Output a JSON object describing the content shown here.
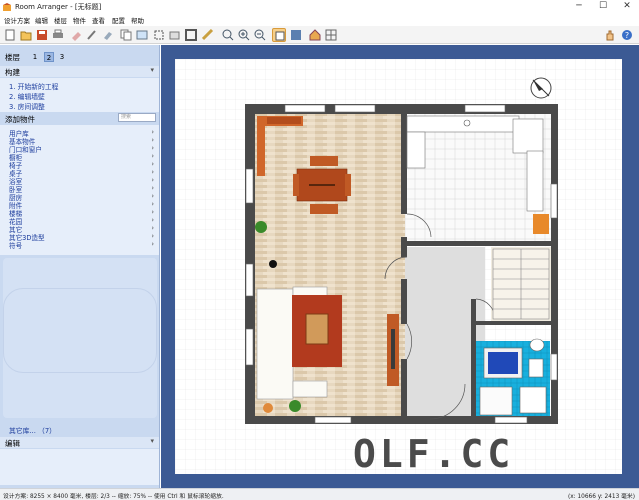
{
  "window": {
    "title": "Room Arranger - [无标题]",
    "minimize": "─",
    "maximize": "☐",
    "close": "✕"
  },
  "menu": [
    "设计方案",
    "编辑",
    "楼层",
    "物件",
    "查看",
    "配置",
    "帮助"
  ],
  "toolbar": {
    "icons": [
      "new-file-icon",
      "open-folder-icon",
      "save-icon",
      "print-icon",
      "eraser-icon",
      "brush-icon",
      "paint-icon",
      "copy-icon",
      "export-icon",
      "select-icon",
      "import-icon",
      "wall-icon",
      "ruler-icon",
      "zoom-fit-icon",
      "zoom-in-icon",
      "zoom-out-icon",
      "view-2d-icon",
      "view-3d-icon",
      "house-3d-icon",
      "grid-icon",
      "hand-icon",
      "help-icon"
    ],
    "active": [
      "view-2d-icon"
    ]
  },
  "left_panel": {
    "floors_label": "楼层",
    "floors": [
      "1",
      "2",
      "3"
    ],
    "active_floor": "2",
    "build_header": "构建",
    "steps": [
      "1.  开始新的工程",
      "2.  编辑墙壁",
      "3.  房间调整"
    ],
    "add_objects_label": "添加物件",
    "search_placeholder": "搜索",
    "categories": [
      "用户库",
      "基本物件",
      "门口和窗户",
      "橱柜",
      "椅子",
      "桌子",
      "浴室",
      "卧室",
      "厨房",
      "附件",
      "楼梯",
      "花园",
      "其它",
      "其它3D造型",
      "符号"
    ],
    "more_libraries": "其它库... （7）",
    "edit_header": "编辑"
  },
  "status_bar": {
    "left": "设计方案: 8255 × 8400 毫米, 楼层: 2/3 -- 缩放: 75% -- 使用 Ctrl 和 鼠标滚轮缩放.",
    "right": "(x: 10666 y: 2413 毫米)"
  },
  "watermark": "OLF.CC",
  "colors": {
    "canvas_bg": "#3c5a94",
    "panel_bg": "#c9d9f0",
    "wall": "#4a4a4a",
    "wood_floor": "#e6d7bf",
    "tile_blue": "#19b3e0",
    "orange": "#e8892a",
    "red_brown": "#b23a1e"
  }
}
